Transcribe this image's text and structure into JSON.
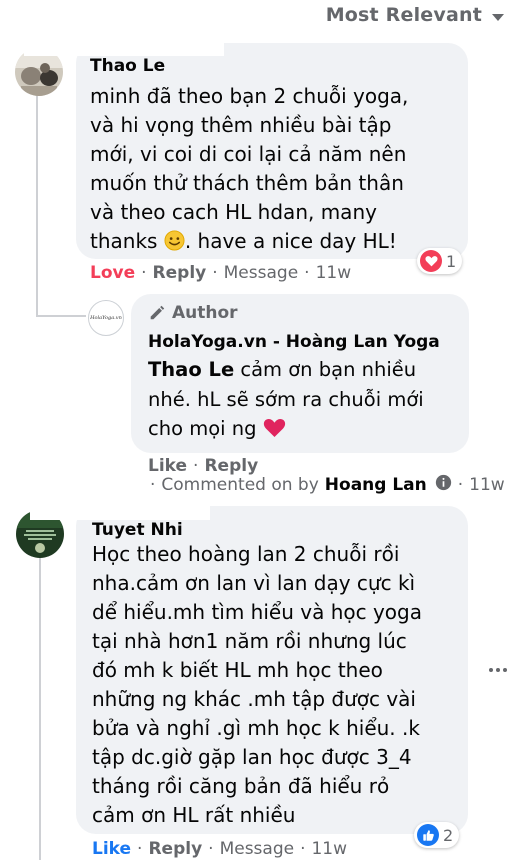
{
  "sort": {
    "label": "Most Relevant"
  },
  "comments": [
    {
      "author": "Thao Le",
      "lines": [
        "minh đã theo bạn 2 chuỗi yoga,",
        "và hi vọng thêm nhiều bài tập",
        "mới, vi coi di coi lại cả năm nên",
        "muốn thử thách thêm bản thân",
        "và theo cach HL hdan, many"
      ],
      "last_line_before": "thanks ",
      "last_line_after": ". have a nice day HL!",
      "emoji": "smiling-face",
      "reaction": {
        "type": "love",
        "count": "1"
      },
      "actions": {
        "love": "Love",
        "reply": "Reply",
        "message": "Message",
        "time": "11w"
      },
      "colors": {
        "love": "#f33e58"
      }
    },
    {
      "author": "Tuyet Nhi",
      "lines": [
        "Học theo hoàng lan 2 chuỗi rồi",
        "nha.cảm ơn lan vì lan dạy cực kì",
        "dể hiểu.mh tìm hiểu và học yoga",
        "tại nhà hơn1 năm rồi nhưng lúc",
        "đó mh k biết HL mh học theo",
        "những ng khác .mh tập được vài",
        "bửa và nghỉ .gì mh học k hiểu. .k",
        "tập dc.giờ gặp lan học được 3_4",
        "tháng rồi căng bản đã hiểu rỏ",
        "cảm ơn HL rất nhiều"
      ],
      "reaction": {
        "type": "like",
        "count": "2"
      },
      "actions": {
        "like": "Like",
        "reply": "Reply",
        "message": "Message",
        "time": "11w"
      },
      "colors": {
        "like": "#1877f2"
      }
    }
  ],
  "reply": {
    "badge": "Author",
    "page_name": "HolaYoga.vn - Hoàng Lan Yoga",
    "mention": "Thao Le",
    "line1_rest": " cảm ơn bạn nhiều",
    "lines": [
      "nhé. hL sẽ sớm ra chuỗi mới"
    ],
    "last_line": "cho mọi ng ",
    "emoji": "red-heart",
    "avatar_text": "HolaYoga.vn",
    "actions": {
      "like": "Like",
      "reply": "Reply"
    },
    "commented_by_prefix": "Commented on by",
    "commented_by_name": "Hoang Lan",
    "time": "11w"
  },
  "colors": {
    "bubble": "#f0f2f5",
    "secondary_text": "#65676b",
    "thread_line": "#ced0d4",
    "heart": "#f33e58",
    "like": "#1877f2"
  }
}
